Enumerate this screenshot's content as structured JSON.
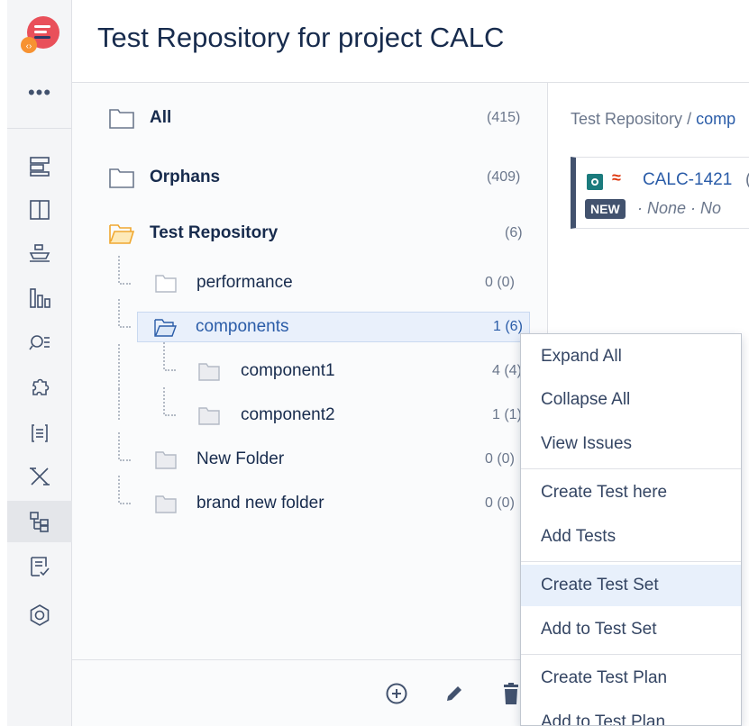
{
  "header": {
    "title": "Test Repository for project CALC"
  },
  "rail": {
    "more": "•••",
    "items": [
      {
        "icon": "backlog-icon"
      },
      {
        "icon": "board-icon"
      },
      {
        "icon": "releases-icon"
      },
      {
        "icon": "reports-icon"
      },
      {
        "icon": "issue-search-icon"
      },
      {
        "icon": "add-ons-icon"
      },
      {
        "icon": "code-icon"
      },
      {
        "icon": "test-execution-icon"
      },
      {
        "icon": "test-repository-icon",
        "active": true
      },
      {
        "icon": "test-plan-board-icon"
      },
      {
        "icon": "settings-icon"
      }
    ]
  },
  "tree": {
    "all": {
      "label": "All",
      "count": "(415)"
    },
    "orphans": {
      "label": "Orphans",
      "count": "(409)"
    },
    "repository": {
      "label": "Test Repository",
      "count": "(6)"
    },
    "performance": {
      "label": "performance",
      "count": "0 (0)"
    },
    "components": {
      "label": "components",
      "count": "1 (6)"
    },
    "component1": {
      "label": "component1",
      "count": "4 (4)"
    },
    "component2": {
      "label": "component2",
      "count": "1 (1)"
    },
    "new_folder": {
      "label": "New Folder",
      "count": "0 (0)"
    },
    "brand_new_folder": {
      "label": "brand new folder",
      "count": "0 (0)"
    }
  },
  "right": {
    "breadcrumb_root": "Test Repository",
    "breadcrumb_sep": " / ",
    "breadcrumb_current": "comp",
    "card": {
      "priority": "≈",
      "key": "CALC-1421",
      "key_trailing": "(",
      "status": "NEW",
      "meta": "· None · No"
    }
  },
  "menu": {
    "items": [
      "Expand All",
      "Collapse All",
      "View Issues",
      "Create Test here",
      "Add Tests",
      "Create Test Set",
      "Add to Test Set",
      "Create Test Plan",
      "Add to Test Plan"
    ],
    "highlighted": "Create Test Set"
  },
  "colors": {
    "accent": "#2a5ca8",
    "selected_bg": "#e9f0fb",
    "status_bg": "#42526e",
    "priority": "#de350b",
    "test_type": "#1b7b7d",
    "open_folder": "#f6c343"
  }
}
